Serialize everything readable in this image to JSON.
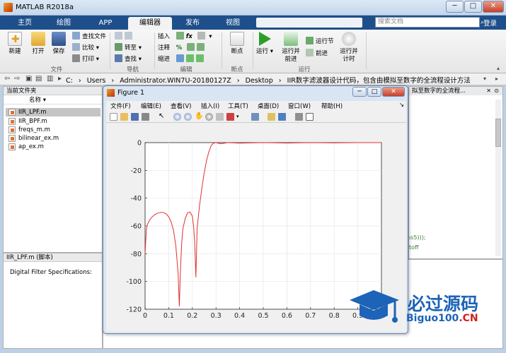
{
  "window": {
    "title": "MATLAB R2018a",
    "minimize": "─",
    "maximize": "□",
    "close": "✕"
  },
  "ribbon_tabs": [
    "主页",
    "绘图",
    "APP",
    "编辑器",
    "发布",
    "视图"
  ],
  "search_placeholder": "搜索文档",
  "login": "登录",
  "ribbon": {
    "file": {
      "new": "新建",
      "open": "打开",
      "save": "保存",
      "find_files": "查找文件",
      "compare": "比较",
      "print": "打印",
      "label": "文件"
    },
    "navigate": {
      "goto": "转至",
      "find": "查找",
      "label": "导航"
    },
    "edit": {
      "insert": "插入",
      "comment": "注释",
      "indent": "缩进",
      "label": "编辑"
    },
    "breakpoints": {
      "breakpoint": "断点",
      "label": "断点"
    },
    "run": {
      "run": "运行",
      "run_advance": "运行并\n前进",
      "run_section": "运行节",
      "advance": "前进",
      "run_time": "运行并\n计时",
      "label": "运行"
    }
  },
  "address": {
    "path": [
      "C:",
      "›",
      "Users",
      "›",
      "Administrator.WIN7U-20180127Z",
      "›",
      "Desktop",
      "›",
      "IIR数字滤波器设计代码，包含由模拟至数字的全流程设计方法"
    ]
  },
  "current_folder": {
    "header": "当前文件夹",
    "column": "名称 ▾",
    "files": [
      "IIR_LPF.m",
      "IIR_BPF.m",
      "freqs_m.m",
      "bilinear_ex.m",
      "ap_ex.m"
    ],
    "selected_index": 0
  },
  "details": {
    "header": "IIR_LPF.m  (脚本)",
    "text": "Digital Filter Specifications:"
  },
  "editor": {
    "tab": "拟至数字的全流程...",
    "code_lines": [
      "ıs5)));",
      "toff"
    ]
  },
  "figure": {
    "title": "Figure 1",
    "menus": [
      "文件(F)",
      "编辑(E)",
      "查看(V)",
      "插入(I)",
      "工具(T)",
      "桌面(D)",
      "窗口(W)",
      "帮助(H)"
    ]
  },
  "chart_data": {
    "type": "line",
    "title": "",
    "xlabel": "",
    "ylabel": "",
    "xlim": [
      0,
      1
    ],
    "ylim": [
      -120,
      0
    ],
    "xticks": [
      0,
      0.1,
      0.2,
      0.3,
      0.4,
      0.5,
      0.6,
      0.7,
      0.8,
      0.9
    ],
    "yticks": [
      0,
      -20,
      -40,
      -60,
      -80,
      -100,
      -120
    ],
    "grid": true,
    "series": [
      {
        "name": "",
        "color": "#e03030",
        "x": [
          0,
          0.005,
          0.01,
          0.02,
          0.03,
          0.04,
          0.05,
          0.06,
          0.07,
          0.08,
          0.09,
          0.1,
          0.11,
          0.12,
          0.13,
          0.14,
          0.145,
          0.15,
          0.155,
          0.16,
          0.17,
          0.18,
          0.19,
          0.2,
          0.205,
          0.21,
          0.215,
          0.22,
          0.23,
          0.24,
          0.25,
          0.26,
          0.27,
          0.28,
          0.29,
          0.3,
          0.32,
          0.35,
          0.4,
          0.5,
          0.6,
          0.7,
          0.8,
          0.9,
          1.0
        ],
        "y": [
          -80,
          -63,
          -59,
          -55.5,
          -53.5,
          -52,
          -51,
          -50.5,
          -50.2,
          -50.5,
          -51.5,
          -53.5,
          -57,
          -63,
          -74,
          -95,
          -118,
          -90,
          -72,
          -62,
          -54.5,
          -50.5,
          -50,
          -53,
          -60,
          -72,
          -97,
          -62,
          -46,
          -33,
          -22,
          -13,
          -6.5,
          -2,
          -0.3,
          0,
          -0.8,
          0,
          -0.4,
          0,
          -0.3,
          0,
          -0.2,
          0,
          0
        ]
      }
    ]
  },
  "watermark": {
    "cn": "必过源码",
    "en": "Biguo100",
    "domain": ".CN"
  },
  "colors": {
    "ribbon_blue": "#1e4f8a",
    "line": "#e03030",
    "watermark": "#1d63b7"
  }
}
